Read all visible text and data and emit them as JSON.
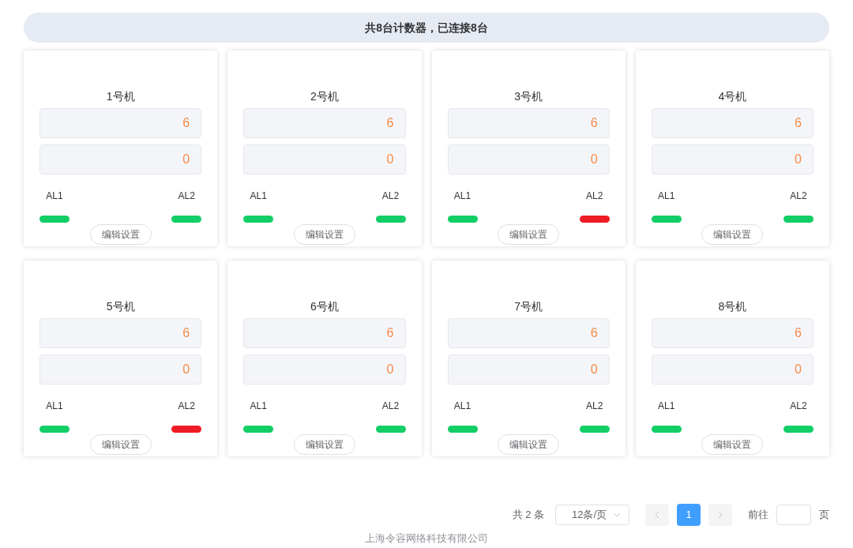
{
  "summary": "共8台计数器，已连接8台",
  "counters": [
    {
      "name": "1号机",
      "value_1": "6",
      "value_2": "0",
      "alarms": [
        {
          "label": "AL1",
          "on": false
        },
        {
          "label": "AL2",
          "on": false
        }
      ],
      "button": "编辑设置"
    },
    {
      "name": "2号机",
      "value_1": "6",
      "value_2": "0",
      "alarms": [
        {
          "label": "AL1",
          "on": false
        },
        {
          "label": "AL2",
          "on": false
        }
      ],
      "button": "编辑设置"
    },
    {
      "name": "3号机",
      "value_1": "6",
      "value_2": "0",
      "alarms": [
        {
          "label": "AL1",
          "on": false
        },
        {
          "label": "AL2",
          "on": true
        }
      ],
      "button": "编辑设置"
    },
    {
      "name": "4号机",
      "value_1": "6",
      "value_2": "0",
      "alarms": [
        {
          "label": "AL1",
          "on": false
        },
        {
          "label": "AL2",
          "on": false
        }
      ],
      "button": "编辑设置"
    },
    {
      "name": "5号机",
      "value_1": "6",
      "value_2": "0",
      "alarms": [
        {
          "label": "AL1",
          "on": false
        },
        {
          "label": "AL2",
          "on": true
        }
      ],
      "button": "编辑设置"
    },
    {
      "name": "6号机",
      "value_1": "6",
      "value_2": "0",
      "alarms": [
        {
          "label": "AL1",
          "on": false
        },
        {
          "label": "AL2",
          "on": false
        }
      ],
      "button": "编辑设置"
    },
    {
      "name": "7号机",
      "value_1": "6",
      "value_2": "0",
      "alarms": [
        {
          "label": "AL1",
          "on": false
        },
        {
          "label": "AL2",
          "on": false
        }
      ],
      "button": "编辑设置"
    },
    {
      "name": "8号机",
      "value_1": "6",
      "value_2": "0",
      "alarms": [
        {
          "label": "AL1",
          "on": false
        },
        {
          "label": "AL2",
          "on": false
        }
      ],
      "button": "编辑设置"
    }
  ],
  "pagination": {
    "total": "共 2 条",
    "page_size": "12条/页",
    "pages": [
      {
        "label": "1",
        "selected": true
      }
    ],
    "goto_label": "前往",
    "goto_suffix": "页"
  },
  "footer": "上海令容网络科技有限公司"
}
